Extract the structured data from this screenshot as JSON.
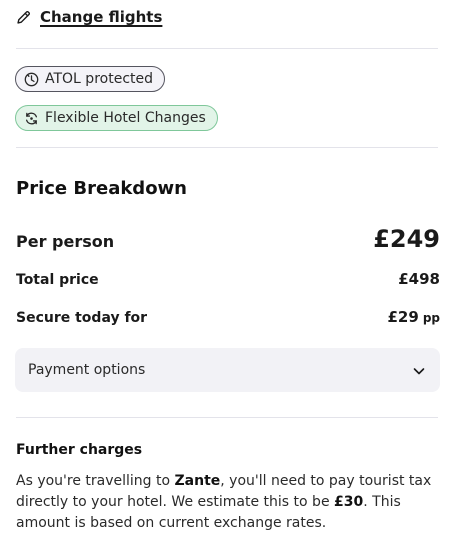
{
  "header": {
    "change_flights_label": "Change flights",
    "change_icon": "pencil-icon"
  },
  "badges": [
    {
      "label": "ATOL protected",
      "icon": "atol-icon",
      "border": "#55555f",
      "bg": "#f4f3f8"
    },
    {
      "label": "Flexible Hotel Changes",
      "icon": "refresh-icon",
      "border": "#7fc79a",
      "bg": "#e2f4e8"
    }
  ],
  "price": {
    "title": "Price Breakdown",
    "per_person_label": "Per person",
    "per_person_value": "£249",
    "total_label": "Total price",
    "total_value": "£498",
    "secure_label": "Secure today for",
    "secure_value": "£29",
    "secure_suffix": "pp"
  },
  "payment": {
    "label": "Payment options",
    "icon": "chevron-down-icon"
  },
  "further": {
    "title": "Further charges",
    "text_1": "As you're travelling to ",
    "destination": "Zante",
    "text_2": ", you'll need to pay tourist tax directly to your hotel. We estimate this to be ",
    "amount": "£30",
    "text_3": ". This amount is based on current exchange rates."
  }
}
